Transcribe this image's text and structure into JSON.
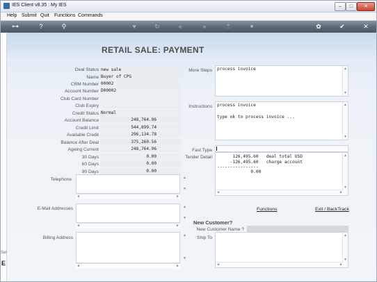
{
  "window": {
    "title": "IES Client v8.35 : My IES",
    "minimize_glyph": "–",
    "maximize_glyph": "□",
    "close_glyph": "✕"
  },
  "menu": [
    "Help",
    "Submit",
    "Quit",
    "Functions",
    "Commands"
  ],
  "toolbar": {
    "icons": [
      "key-icon",
      "help-icon",
      "search-icon",
      "heart-icon",
      "refresh-icon",
      "rewind-icon",
      "fast-forward-icon",
      "upload-icon",
      "save-icon",
      "settings-icon",
      "check-icon",
      "close-icon"
    ],
    "glyphs": {
      "key": "⊶",
      "help": "?",
      "search": "⚲",
      "heart": "♥",
      "refresh": "↻",
      "rewind": "«",
      "forward": "»",
      "upload": "⇡",
      "save": "■",
      "settings": "✿",
      "check": "✔",
      "close": "✕"
    }
  },
  "page": {
    "title": "RETAIL SALE: PAYMENT"
  },
  "fields": [
    {
      "label": "Deal Status",
      "value": "new sale",
      "numeric": false
    },
    {
      "label": "Name",
      "value": "Buyer of CPG",
      "numeric": false
    },
    {
      "label": "CRM Number",
      "value": "00002",
      "numeric": false
    },
    {
      "label": "Account Number",
      "value": "D00002",
      "numeric": false
    },
    {
      "label": "Club Card Number",
      "value": "",
      "numeric": false
    },
    {
      "label": "Club Expiry",
      "value": "",
      "numeric": false
    },
    {
      "label": "Credit Status",
      "value": "Normal",
      "numeric": false
    },
    {
      "label": "Account Balance",
      "value": "248,764.96",
      "numeric": true
    },
    {
      "label": "Credit Limit",
      "value": "544,899.74",
      "numeric": true
    },
    {
      "label": "Available Credit",
      "value": "296,134.78",
      "numeric": true
    },
    {
      "label": "Balance After Deal",
      "value": "375,260.56",
      "numeric": true
    },
    {
      "label": "Ageing Current",
      "value": "248,764.96",
      "numeric": true
    },
    {
      "label": "30 Days",
      "value": "0.00",
      "numeric": true
    },
    {
      "label": "60 Days",
      "value": "0.00",
      "numeric": true
    },
    {
      "label": "90 Days",
      "value": "0.00",
      "numeric": true
    }
  ],
  "left_boxes": {
    "telephone_label": "Telephone",
    "email_label": "E-Mail Addresses",
    "billing_label": "Billing Address"
  },
  "right": {
    "more_steps_label": "More Steps",
    "more_steps_value": "process invoice",
    "instructions_label": "Instructions",
    "instructions_line1": "process invoice",
    "instructions_line2": "type ok to process invoice ...",
    "fast_type_label": "Fast Type",
    "fast_type_value": "",
    "tender_label": "Tender Detail",
    "tender_lines": [
      "      126,495.60   deal total USD",
      "     -126,495.60   charge account",
      "----------------",
      "             0.00"
    ],
    "functions_link": "Functions",
    "exit_link": "Exit / BackTrack",
    "new_customer_title": "New Customer?",
    "new_customer_name_label": "New Customer Name ?",
    "new_customer_name_value": "",
    "ship_to_label": "Ship To"
  },
  "left_strip": {
    "fragment": "Sel",
    "letter": "E"
  },
  "scroll_glyphs": {
    "up": "▲",
    "down": "▼",
    "left": "◄",
    "right": "►"
  },
  "colors": {
    "toolbar_dark": "#4c5663",
    "title_text": "#4e4e4e",
    "field_bg": "#eaedf2",
    "header_gradient": "#c8d8ee"
  }
}
